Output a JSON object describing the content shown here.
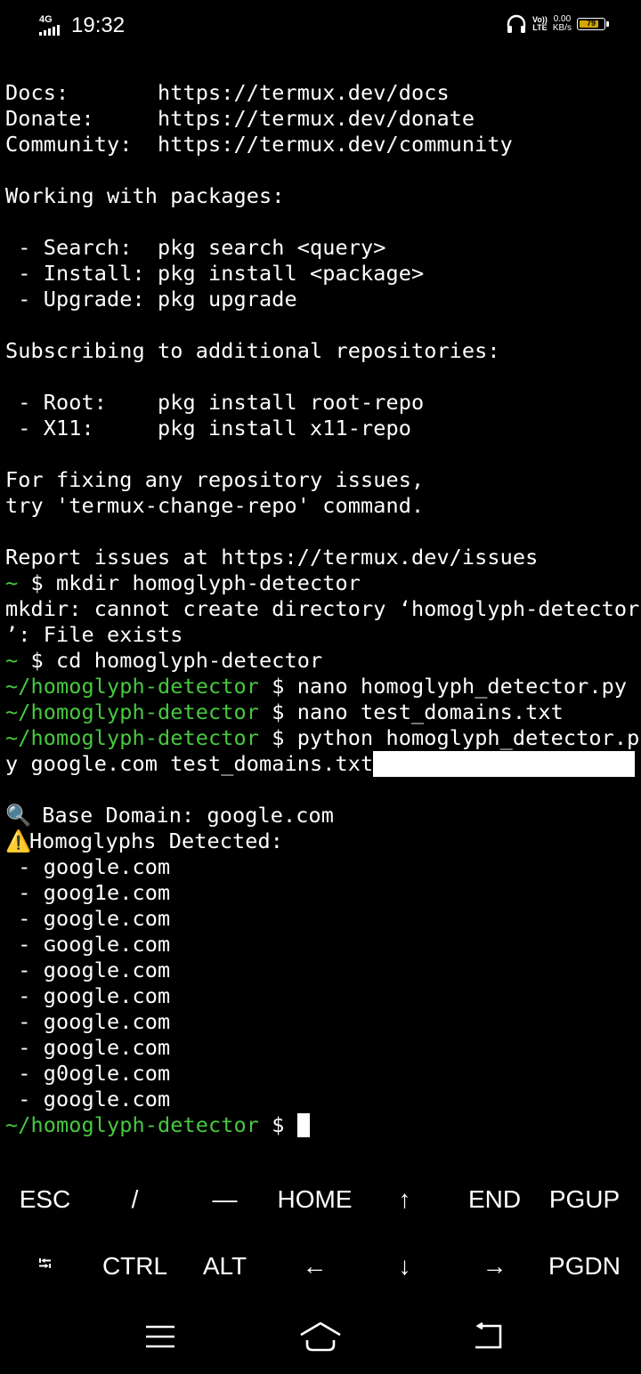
{
  "status_bar": {
    "network": "4G",
    "time": "19:32",
    "volte_top": "Vo))",
    "volte_bottom": "LTE",
    "speed_value": "0.00",
    "speed_unit": "KB/s",
    "battery": "79",
    "battery_level_pct": 79
  },
  "terminal": {
    "lines": [
      [
        {
          "t": "Docs:       https://termux.dev/docs"
        }
      ],
      [
        {
          "t": "Donate:     https://termux.dev/donate"
        }
      ],
      [
        {
          "t": "Community:  https://termux.dev/community"
        }
      ],
      [
        {
          "t": ""
        }
      ],
      [
        {
          "t": "Working with packages:"
        }
      ],
      [
        {
          "t": ""
        }
      ],
      [
        {
          "t": " - Search:  pkg search <query>"
        }
      ],
      [
        {
          "t": " - Install: pkg install <package>"
        }
      ],
      [
        {
          "t": " - Upgrade: pkg upgrade"
        }
      ],
      [
        {
          "t": ""
        }
      ],
      [
        {
          "t": "Subscribing to additional repositories:"
        }
      ],
      [
        {
          "t": ""
        }
      ],
      [
        {
          "t": " - Root:    pkg install root-repo"
        }
      ],
      [
        {
          "t": " - X11:     pkg install x11-repo"
        }
      ],
      [
        {
          "t": ""
        }
      ],
      [
        {
          "t": "For fixing any repository issues,"
        }
      ],
      [
        {
          "t": "try 'termux-change-repo' command."
        }
      ],
      [
        {
          "t": ""
        }
      ],
      [
        {
          "t": "Report issues at https://termux.dev/issues"
        }
      ],
      [
        {
          "t": "~",
          "c": "g"
        },
        {
          "t": " $ mkdir homoglyph-detector"
        }
      ],
      [
        {
          "t": "mkdir: cannot create directory ‘homoglyph-detector"
        }
      ],
      [
        {
          "t": "’: File exists"
        }
      ],
      [
        {
          "t": "~",
          "c": "g"
        },
        {
          "t": " $ cd homoglyph-detector"
        }
      ],
      [
        {
          "t": "~/homoglyph-detector",
          "c": "g"
        },
        {
          "t": " $ nano homoglyph_detector.py"
        }
      ],
      [
        {
          "t": "~/homoglyph-detector",
          "c": "g"
        },
        {
          "t": " $ nano test_domains.txt"
        }
      ],
      [
        {
          "t": "~/homoglyph-detector",
          "c": "g"
        },
        {
          "t": " $ python homoglyph_detector.p"
        }
      ],
      [
        {
          "t": "y google.com test_domains.txt"
        },
        {
          "t": "",
          "c": "sel"
        }
      ],
      [
        {
          "t": ""
        }
      ],
      [
        {
          "t": "🔍",
          "c": "emoji"
        },
        {
          "t": " Base Domain: google.com"
        }
      ],
      [
        {
          "t": "⚠️",
          "c": "emoji"
        },
        {
          "t": "Homoglyphs Detected:"
        }
      ],
      [
        {
          "t": " - google.com"
        }
      ],
      [
        {
          "t": " - goog1e.com"
        }
      ],
      [
        {
          "t": " - google.com"
        }
      ],
      [
        {
          "t": " - ɢoogle.com"
        }
      ],
      [
        {
          "t": " - google.com"
        }
      ],
      [
        {
          "t": " - google.com"
        }
      ],
      [
        {
          "t": " - google.com"
        }
      ],
      [
        {
          "t": " - google.com"
        }
      ],
      [
        {
          "t": " - g0ogle.com"
        }
      ],
      [
        {
          "t": " - google.com"
        }
      ],
      [
        {
          "t": "~/homoglyph-detector",
          "c": "g"
        },
        {
          "t": " $ "
        },
        {
          "t": "",
          "c": "cursor"
        }
      ]
    ]
  },
  "extra_keys": {
    "row1": [
      "ESC",
      "/",
      "—",
      "HOME",
      "↑",
      "END",
      "PGUP"
    ],
    "row2": [
      "⭾",
      "CTRL",
      "ALT",
      "←",
      "↓",
      "→",
      "PGDN"
    ]
  },
  "nav_bar": {
    "menu_icon": "menu-icon",
    "home_icon": "home-icon",
    "back_icon": "back-icon"
  }
}
